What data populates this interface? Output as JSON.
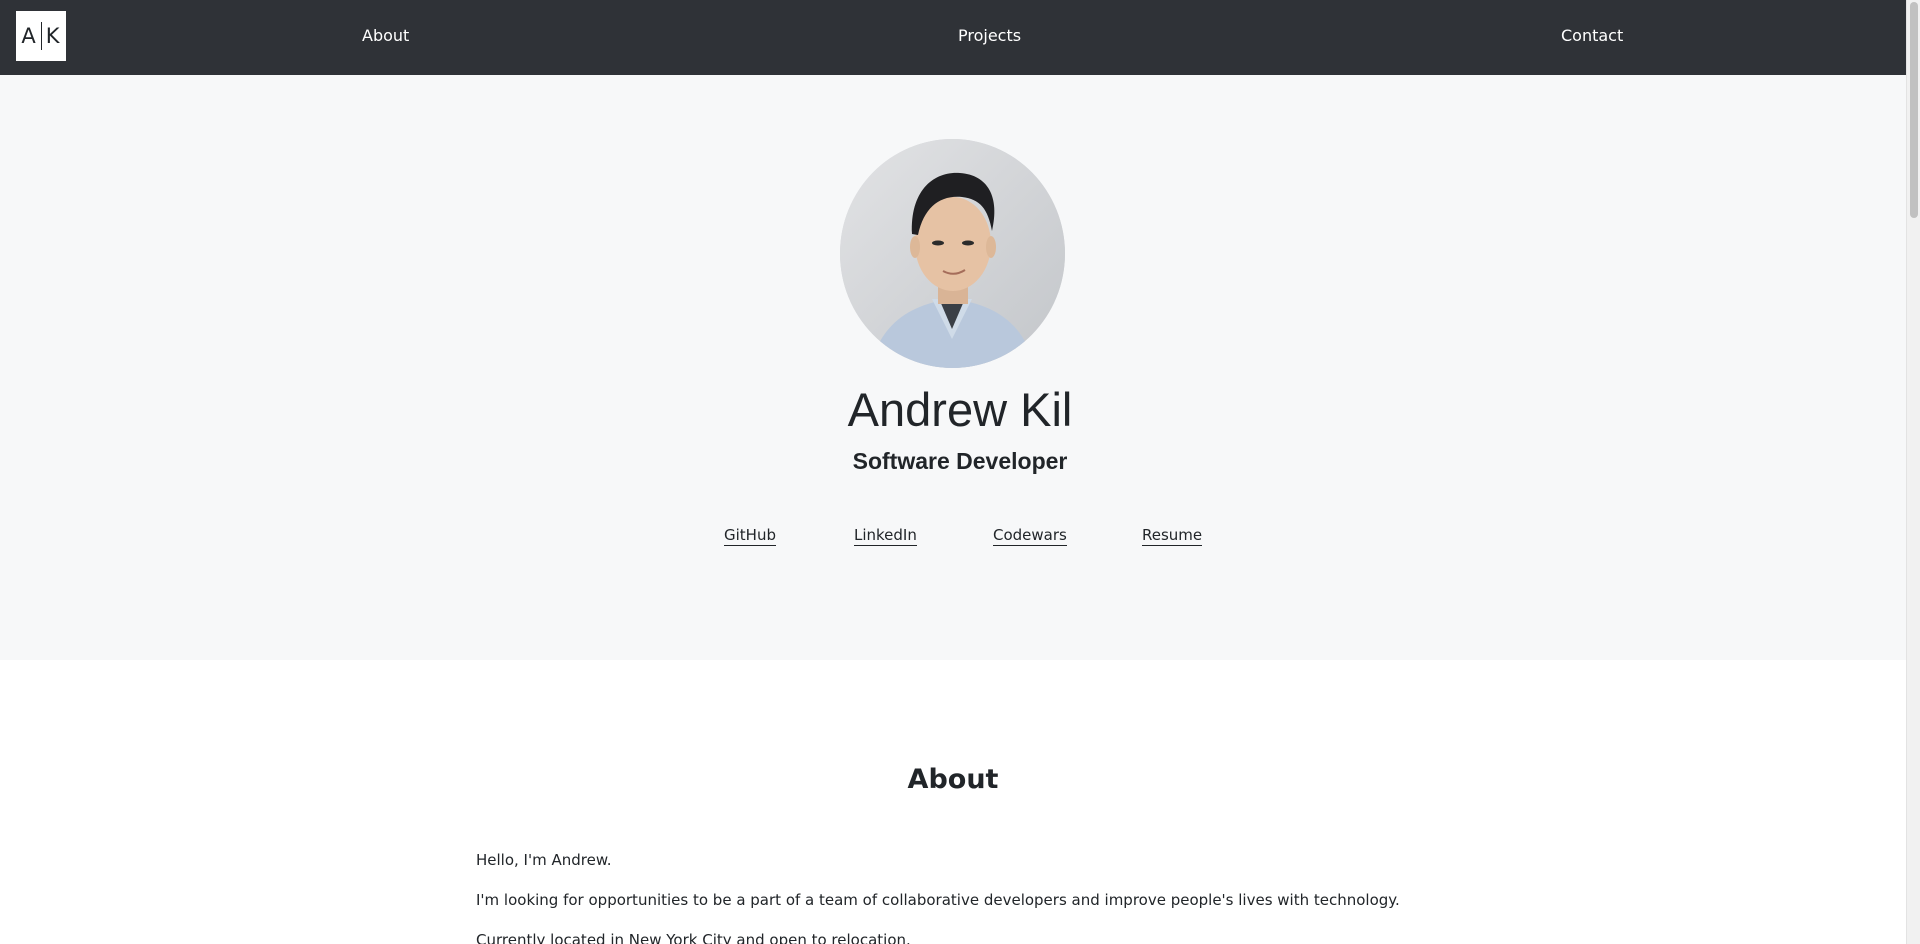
{
  "navbar": {
    "logo_left": "A",
    "logo_right": "K",
    "links": [
      "About",
      "Projects",
      "Contact"
    ]
  },
  "hero": {
    "name": "Andrew Kil",
    "title": "Software Developer",
    "social_links": [
      "GitHub",
      "LinkedIn",
      "Codewars",
      "Resume"
    ]
  },
  "about": {
    "heading": "About",
    "paragraphs": [
      "Hello, I'm Andrew.",
      "I'm looking for opportunities to be a part of a team of collaborative developers and improve people's lives with technology.",
      "Currently located in New York City and open to relocation."
    ]
  },
  "colors": {
    "navbar_bg": "#2f3237",
    "hero_bg": "#f7f8f9",
    "text": "#212529"
  }
}
